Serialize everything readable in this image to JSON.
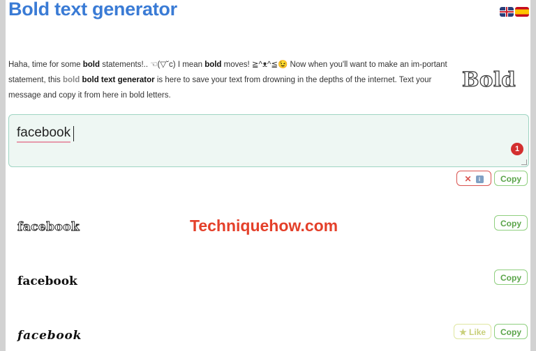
{
  "header": {
    "title": "Bold text generator",
    "flags": [
      "uk-flag-icon",
      "spain-flag-icon"
    ]
  },
  "intro": {
    "s1": "Haha, time for some ",
    "b1": "bold",
    "s2": " statements!.. ☜(▽˘c) I mean ",
    "b2": "bold",
    "s3": " moves! ≧^ᴥ^≦😉  Now when you'll want to make an im-portant statement, this ",
    "faint": "bold",
    "s4": " ",
    "b3": "bold text generator",
    "s5": " is here to save your text from drowning in the depths of the internet. Text your message and copy it from here in bold letters."
  },
  "logo_text": "Bold",
  "input": {
    "value": "facebook",
    "count": "1"
  },
  "controls": {
    "clear_label": "✕",
    "info_label": "i",
    "copy_label": "Copy"
  },
  "results": [
    {
      "text": "facebook",
      "copy_label": "Copy"
    },
    {
      "text": "facebook",
      "copy_label": "Copy"
    },
    {
      "text": "facebook",
      "copy_label": "Copy",
      "like_label": "★ Like"
    }
  ],
  "watermark": "Techniquehow.com",
  "colors": {
    "title": "#3a7bd5",
    "copy_button": "#5aa449",
    "clear_button": "#d9534f",
    "watermark": "#e4402a",
    "badge": "#d32f2f"
  }
}
